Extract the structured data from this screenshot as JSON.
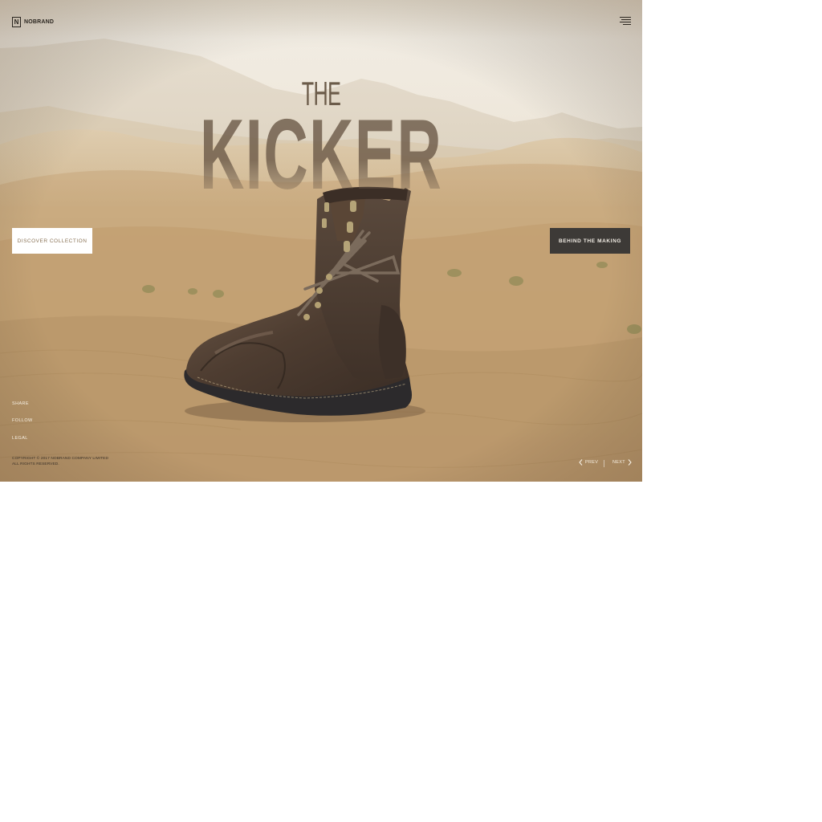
{
  "brand": {
    "logo_letter": "N",
    "name": "NOBRAND"
  },
  "header": {
    "menu_icon": "hamburger-menu-icon"
  },
  "hero": {
    "title_small": "THE",
    "title_large": "KICKER",
    "product_image": "leather-boot"
  },
  "actions": {
    "discover_label": "DISCOVER COLLECTION",
    "behind_label": "BEHIND THE MAKING"
  },
  "sidebar": {
    "links": [
      "SHARE",
      "FOLLOW",
      "LEGAL"
    ]
  },
  "footer": {
    "copyright_line1": "COPYRIGHT © 2017 NOBRAND COMPANY LIMITED",
    "copyright_line2": "ALL RIGHTS RESERVED."
  },
  "pager": {
    "prev_label": "PREV",
    "next_label": "NEXT"
  },
  "colors": {
    "dark_button": "#3d3a37",
    "accent_text": "#8a7356",
    "sand": "#c9ab80"
  }
}
